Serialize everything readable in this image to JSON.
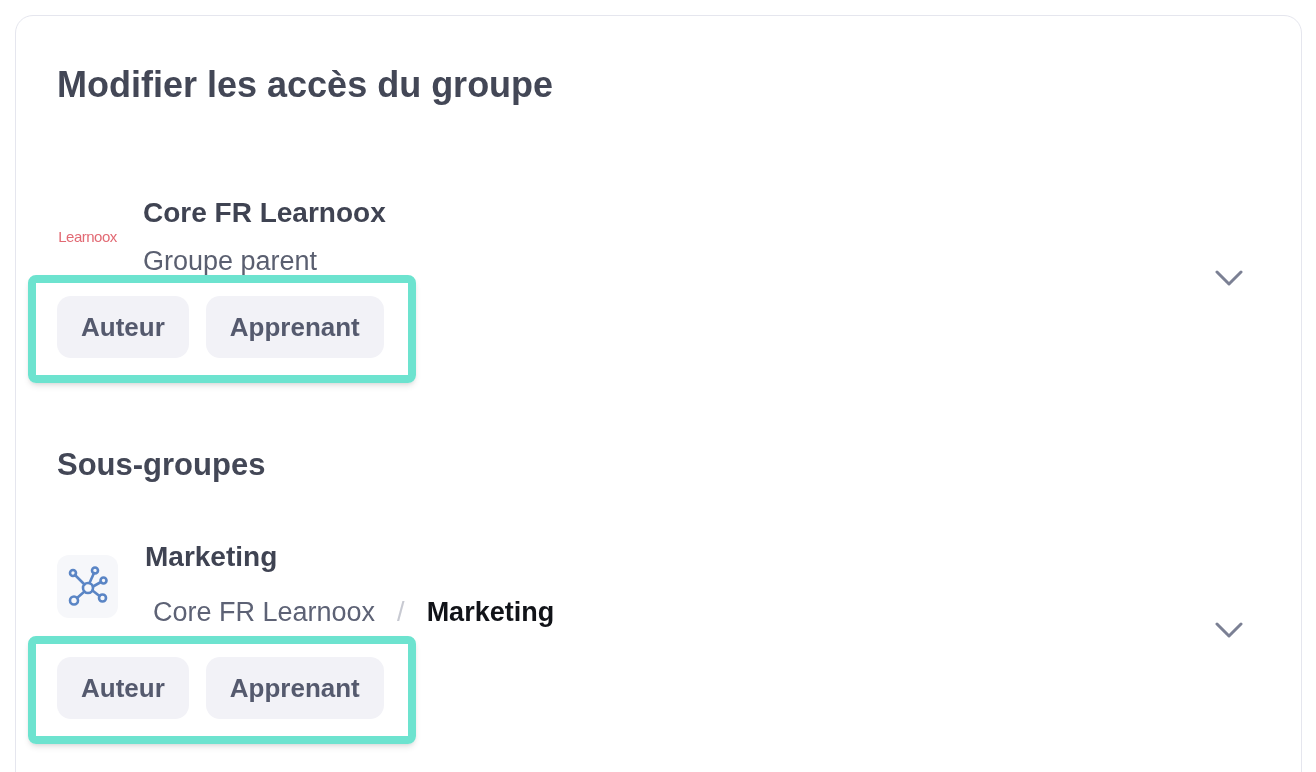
{
  "title": "Modifier les accès du groupe",
  "parent_group": {
    "logo_text": "Learnoox",
    "name": "Core FR Learnoox",
    "subtitle": "Groupe parent",
    "roles": [
      {
        "label": "Auteur"
      },
      {
        "label": "Apprenant"
      }
    ],
    "highlighted": true,
    "expanded": false
  },
  "subgroups_heading": "Sous-groupes",
  "subgroups": [
    {
      "name": "Marketing",
      "breadcrumb": [
        {
          "label": "Core FR Learnoox",
          "current": false
        },
        {
          "label": "Marketing",
          "current": true
        }
      ],
      "separator": "/",
      "roles": [
        {
          "label": "Auteur"
        },
        {
          "label": "Apprenant"
        }
      ],
      "highlighted": true,
      "expanded": false
    }
  ]
}
